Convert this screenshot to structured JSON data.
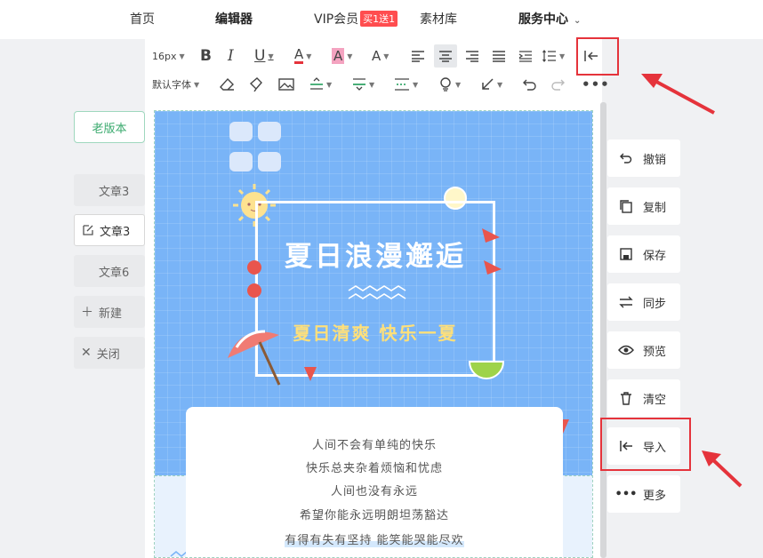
{
  "nav": {
    "home": "首页",
    "editor": "编辑器",
    "vip": "VIP会员",
    "vip_badge": "买1送1",
    "materials": "素材库",
    "service": "服务中心"
  },
  "sidebar": {
    "old_version": "老版本",
    "items": [
      {
        "label": "文章3"
      },
      {
        "label": "文章3"
      },
      {
        "label": "文章6"
      },
      {
        "label": "新建"
      },
      {
        "label": "关闭"
      }
    ]
  },
  "toolbar": {
    "font_size": "16px",
    "font_family": "默认字体"
  },
  "poster": {
    "title": "夏日浪漫邂逅",
    "subtitle": "夏日清爽 快乐一夏",
    "lines": [
      "人间不会有单纯的快乐",
      "快乐总夹杂着烦恼和忧虑",
      "人间也没有永远",
      "希望你能永远明朗坦荡豁达",
      "有得有失有坚持 能笑能哭能尽欢"
    ]
  },
  "right_panel": {
    "undo": "撤销",
    "copy": "复制",
    "save": "保存",
    "sync": "同步",
    "preview": "预览",
    "clear": "清空",
    "import": "导入",
    "more": "更多"
  },
  "colors": {
    "accent_green": "#3aaa6e",
    "highlight_red": "#e5333b",
    "poster_blue": "#79b4f7",
    "subtitle_yellow": "#ffe07a"
  }
}
